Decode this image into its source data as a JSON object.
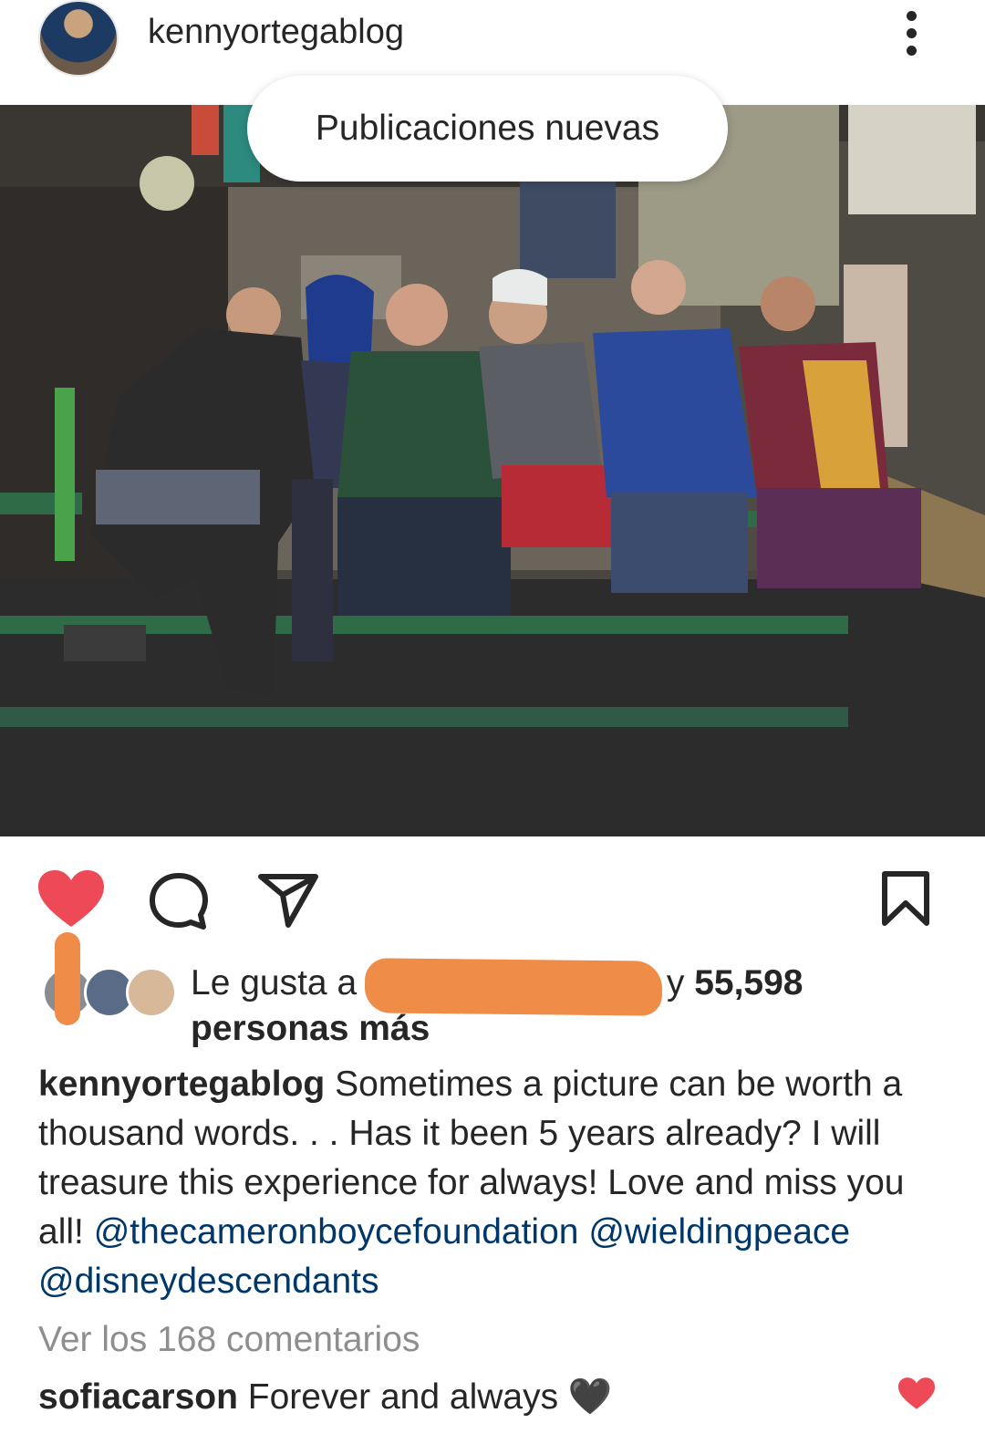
{
  "post": {
    "username": "kennyortegablog",
    "new_posts_label": "Publicaciones nuevas"
  },
  "icons": {
    "avatar": "profile-photo",
    "more": "more-vertical-icon",
    "like": "heart-filled-icon",
    "comment": "speech-bubble-icon",
    "share": "paper-plane-icon",
    "save": "bookmark-icon"
  },
  "colors": {
    "like_red": "#ed4956",
    "mention_blue": "#00376b",
    "muted_gray": "#8e8e8e",
    "redaction_orange": "#ef8c48"
  },
  "likes": {
    "prefix": "Le gusta a",
    "connector": "y",
    "count": "55,598",
    "suffix": "personas más"
  },
  "caption": {
    "username": "kennyortegablog",
    "text": "Sometimes a picture can be worth a thousand words. . . Has it been 5 years already? I will treasure this experience for always! Love and miss you all!",
    "mention1": "@thecameronboycefoundation",
    "mention2": "@wieldingpeace",
    "mention3": "@disneydescendants"
  },
  "comments": {
    "view_all": "Ver los 168 comentarios",
    "top_comment_user": "sofiacarson",
    "top_comment_text": "Forever and always 🖤"
  }
}
